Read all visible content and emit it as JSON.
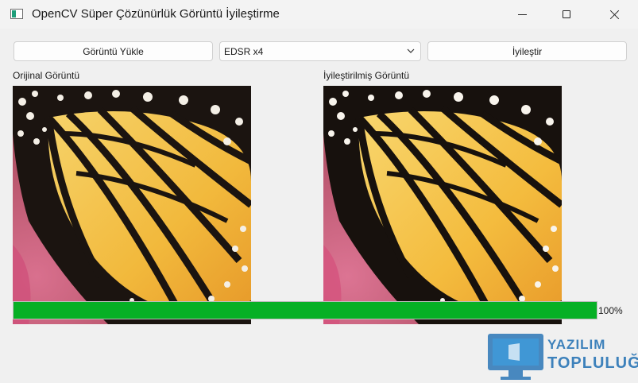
{
  "window": {
    "title": "OpenCV Süper Çözünürlük Görüntü İyileştirme",
    "controls": [
      "minimize",
      "maximize",
      "close"
    ]
  },
  "toolbar": {
    "load_label": "Görüntü Yükle",
    "model_select": {
      "selected": "EDSR x4"
    },
    "enhance_label": "İyileştir"
  },
  "panels": {
    "original_label": "Orijinal Görüntü",
    "enhanced_label": "İyileştirilmiş Görüntü"
  },
  "progress": {
    "value_percent": 100,
    "text": "100%",
    "color": "#06b025"
  },
  "watermark": {
    "line1": "YAZILIM",
    "line2": "TOPLULUĞU",
    "color": "#2a76b6"
  }
}
